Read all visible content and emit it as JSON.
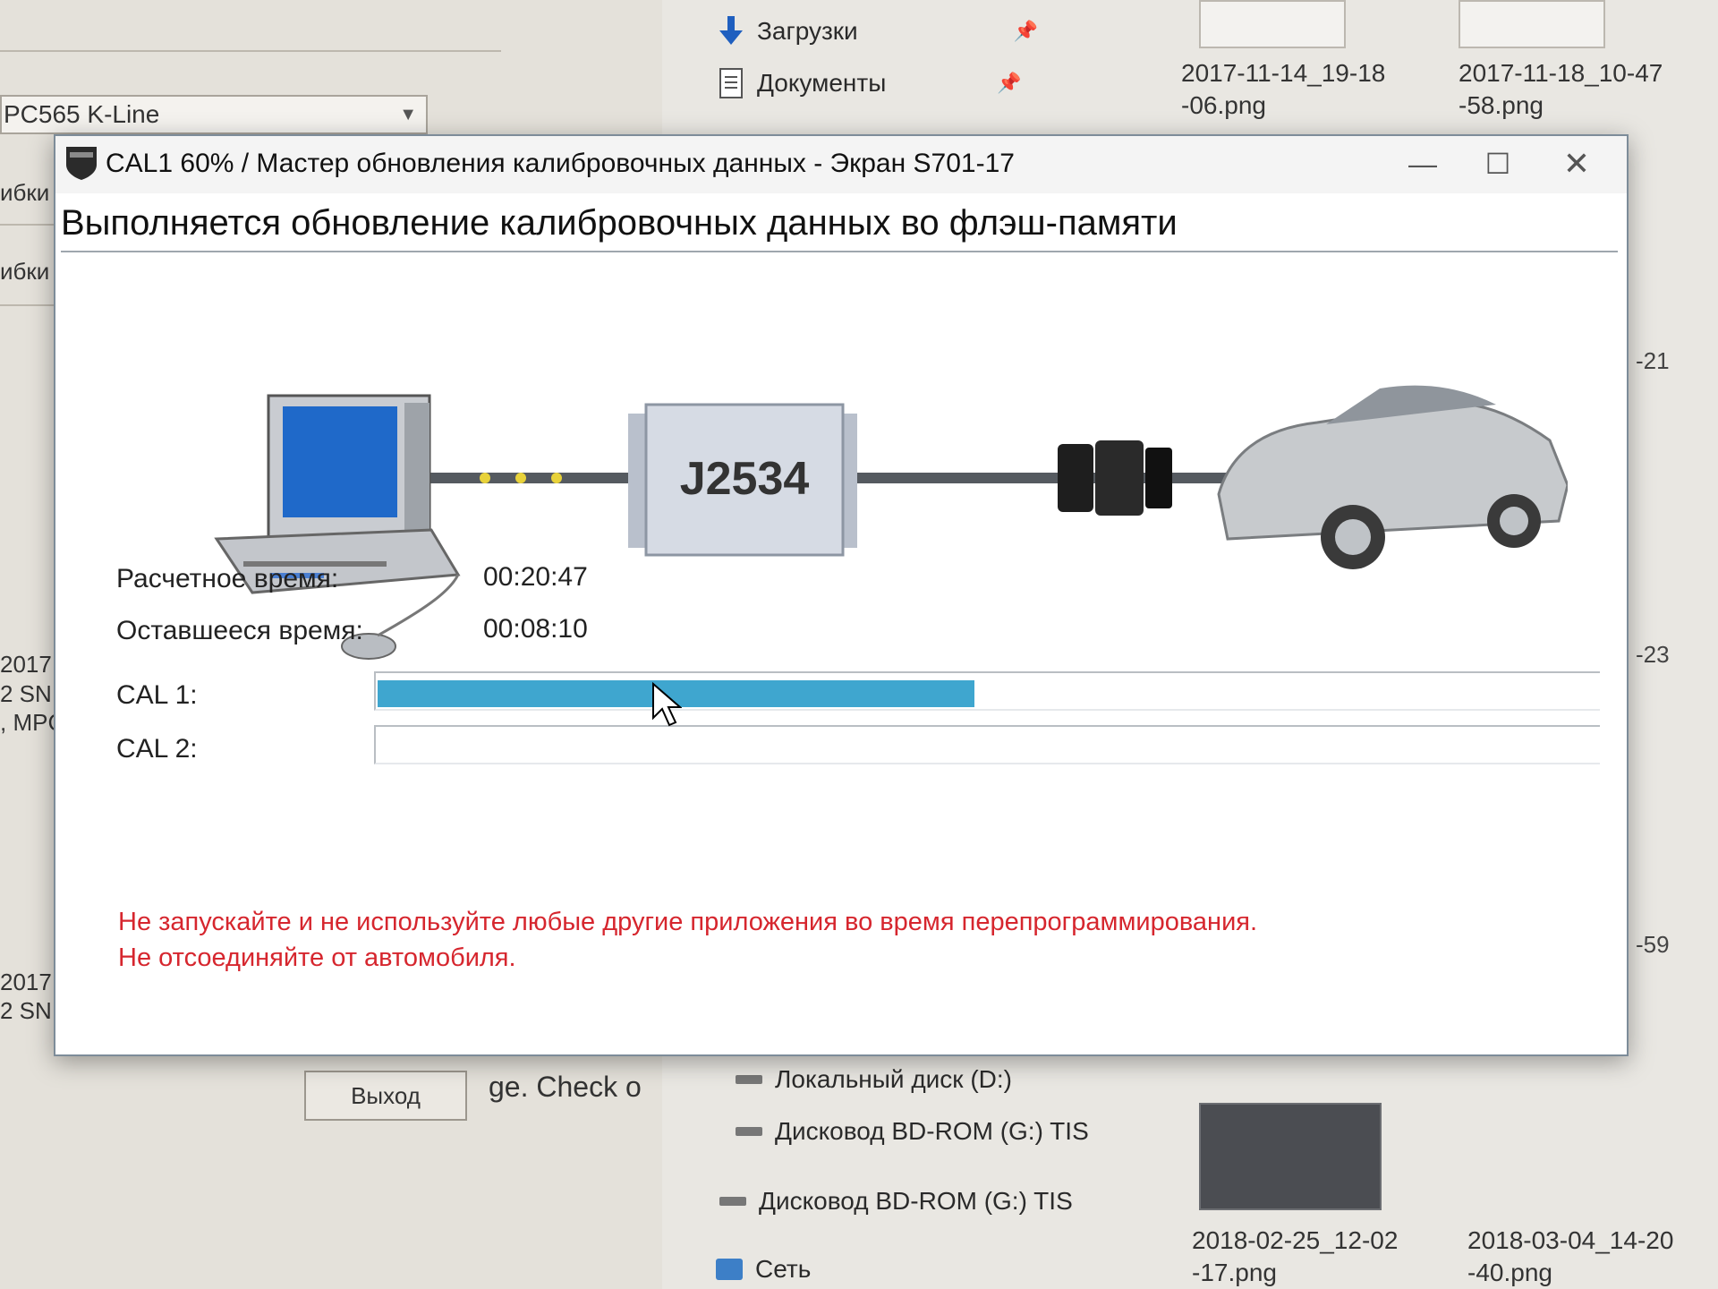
{
  "background": {
    "left_window": {
      "combo_value": "PC565 K-Line",
      "fragments": [
        "ибки",
        "ибки",
        "2017",
        "2 SN",
        ", MPC",
        "2017",
        "2 SN"
      ],
      "exit_button": "Выход",
      "check_text": "ge. Check o"
    },
    "explorer": {
      "nav_downloads": "Загрузки",
      "nav_documents": "Документы",
      "drive_d": "Локальный диск (D:)",
      "drive_g1": "Дисковод BD-ROM (G:) TIS",
      "drive_g2": "Дисковод BD-ROM (G:) TIS",
      "network": "Сеть",
      "thumbnails": [
        {
          "line1": "2017-11-14_19-18",
          "line2": "-06.png"
        },
        {
          "line1": "2017-11-18_10-47",
          "line2": "-58.png"
        },
        {
          "line1": "2018-02-25_12-02",
          "line2": "-17.png"
        },
        {
          "line1": "2018-03-04_14-20",
          "line2": "-40.png"
        }
      ],
      "side_numbers": [
        "-21",
        "-23",
        "-59"
      ]
    }
  },
  "dialog": {
    "title": "CAL1 60% / Мастер обновления калибровочных данных - Экран S701-17",
    "controls": {
      "minimize": "—",
      "maximize": "☐",
      "close": "✕"
    },
    "heading": "Выполняется обновление калибровочных данных во флэш-памяти",
    "diagram": {
      "interface_label": "J2534",
      "icons": [
        "computer-icon",
        "j2534-interface-icon",
        "connector-icon",
        "car-icon"
      ]
    },
    "estimated_time_label": "Расчетное время:",
    "estimated_time_value": "00:20:47",
    "remaining_time_label": "Оставшееся время:",
    "remaining_time_value": "00:08:10",
    "cal1_label": "CAL 1:",
    "cal1_progress": 0.49,
    "cal2_label": "CAL 2:",
    "cal2_progress": 0,
    "progress_color": "#3fa6cf",
    "warning_line1": "Не запускайте и не используйте любые другие приложения во время перепрограммирования.",
    "warning_line2": "Не отсоединяйте от автомобиля.",
    "warning_color": "#d6262e"
  }
}
